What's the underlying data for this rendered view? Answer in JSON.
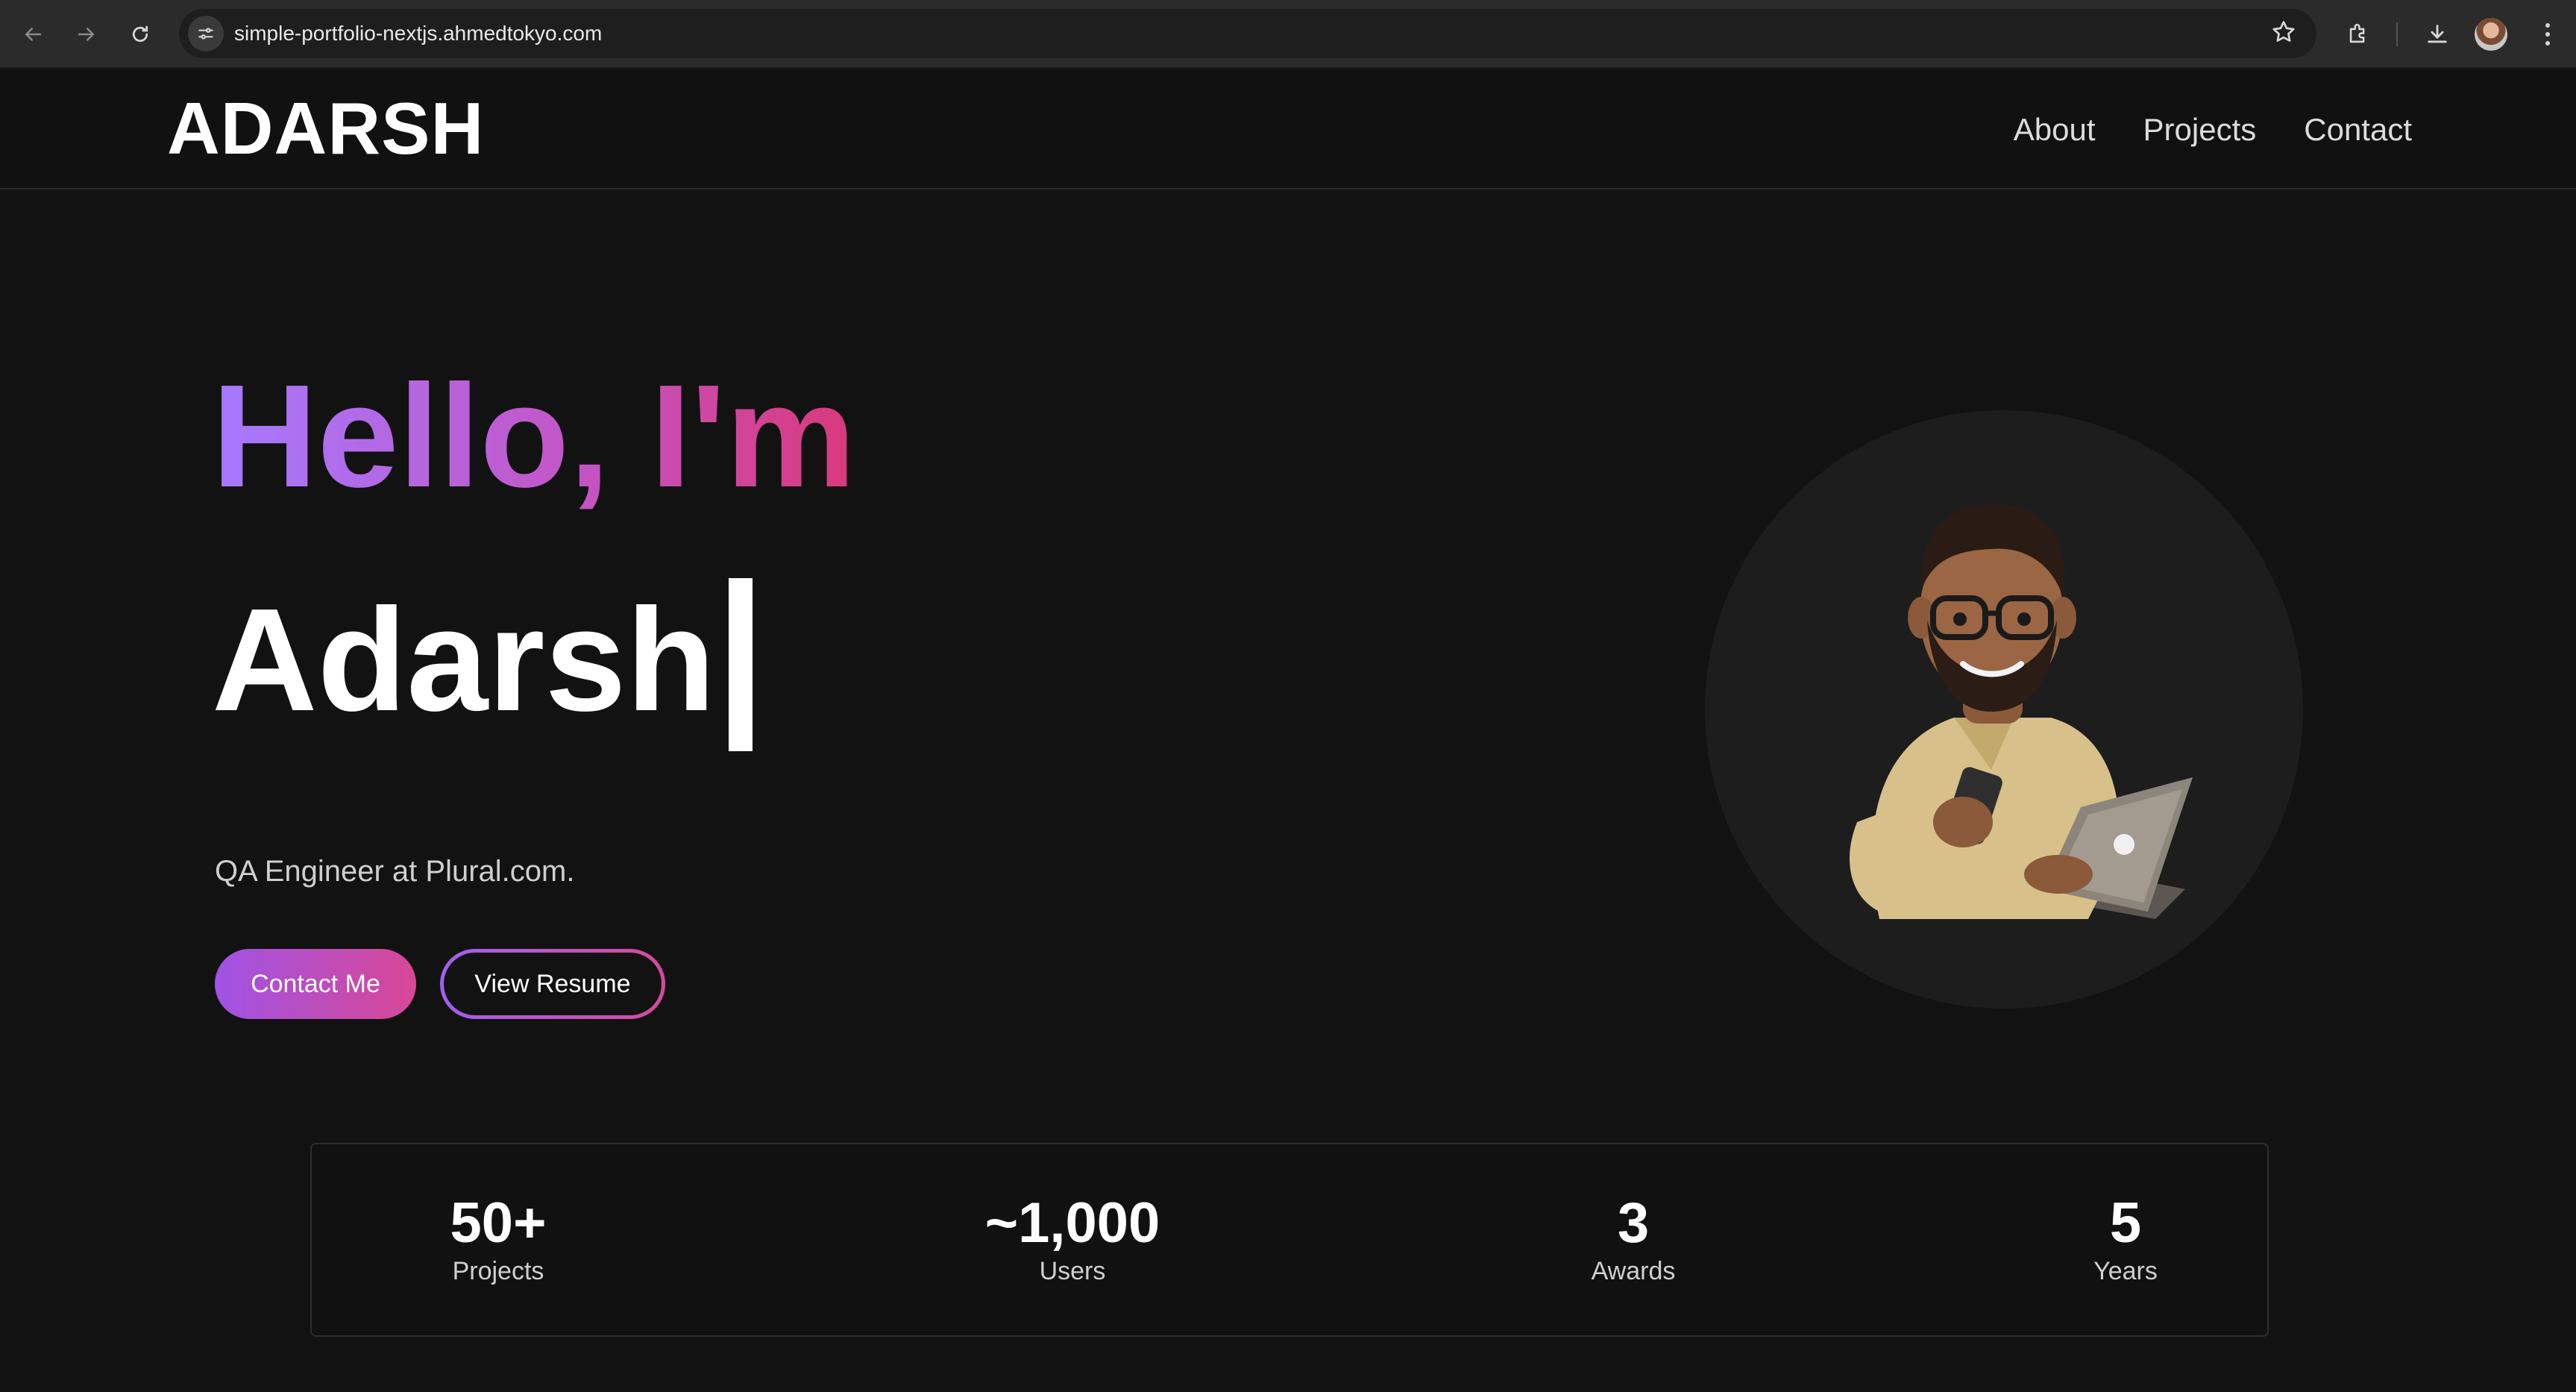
{
  "browser": {
    "url": "simple-portfolio-nextjs.ahmedtokyo.com"
  },
  "header": {
    "logo": "ADARSH",
    "nav": [
      "About",
      "Projects",
      "Contact"
    ]
  },
  "hero": {
    "greeting": "Hello, I'm",
    "name": "Adarsh",
    "subtitle": "QA Engineer at Plural.com.",
    "primary_button": "Contact Me",
    "secondary_button": "View Resume"
  },
  "stats": [
    {
      "value": "50+",
      "label": "Projects"
    },
    {
      "value": "~1,000",
      "label": "Users"
    },
    {
      "value": "3",
      "label": "Awards"
    },
    {
      "value": "5",
      "label": "Years"
    }
  ],
  "colors": {
    "background": "#121212",
    "accent_start": "#a57aff",
    "accent_end": "#d9397a"
  }
}
